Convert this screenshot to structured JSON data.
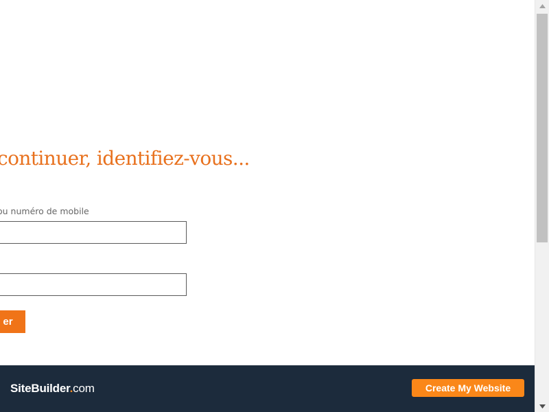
{
  "login": {
    "heading": "continuer, identifiez-vous...",
    "phone_label": "ou numéro de mobile",
    "phone_value": "",
    "password_value": "",
    "submit_label": "er"
  },
  "footer": {
    "brand_name": "SiteBuilder",
    "brand_dot": ".",
    "brand_tld": "com",
    "cta_label": "Create My Website"
  },
  "colors": {
    "heading": "#e8711e",
    "submit_button": "#f07418",
    "footer_background": "#1c2b3c",
    "brand_dot": "#f58a1f",
    "cta_button": "#fa8719"
  },
  "icons": {
    "scroll_up": "triangle-up",
    "scroll_down": "triangle-down"
  }
}
